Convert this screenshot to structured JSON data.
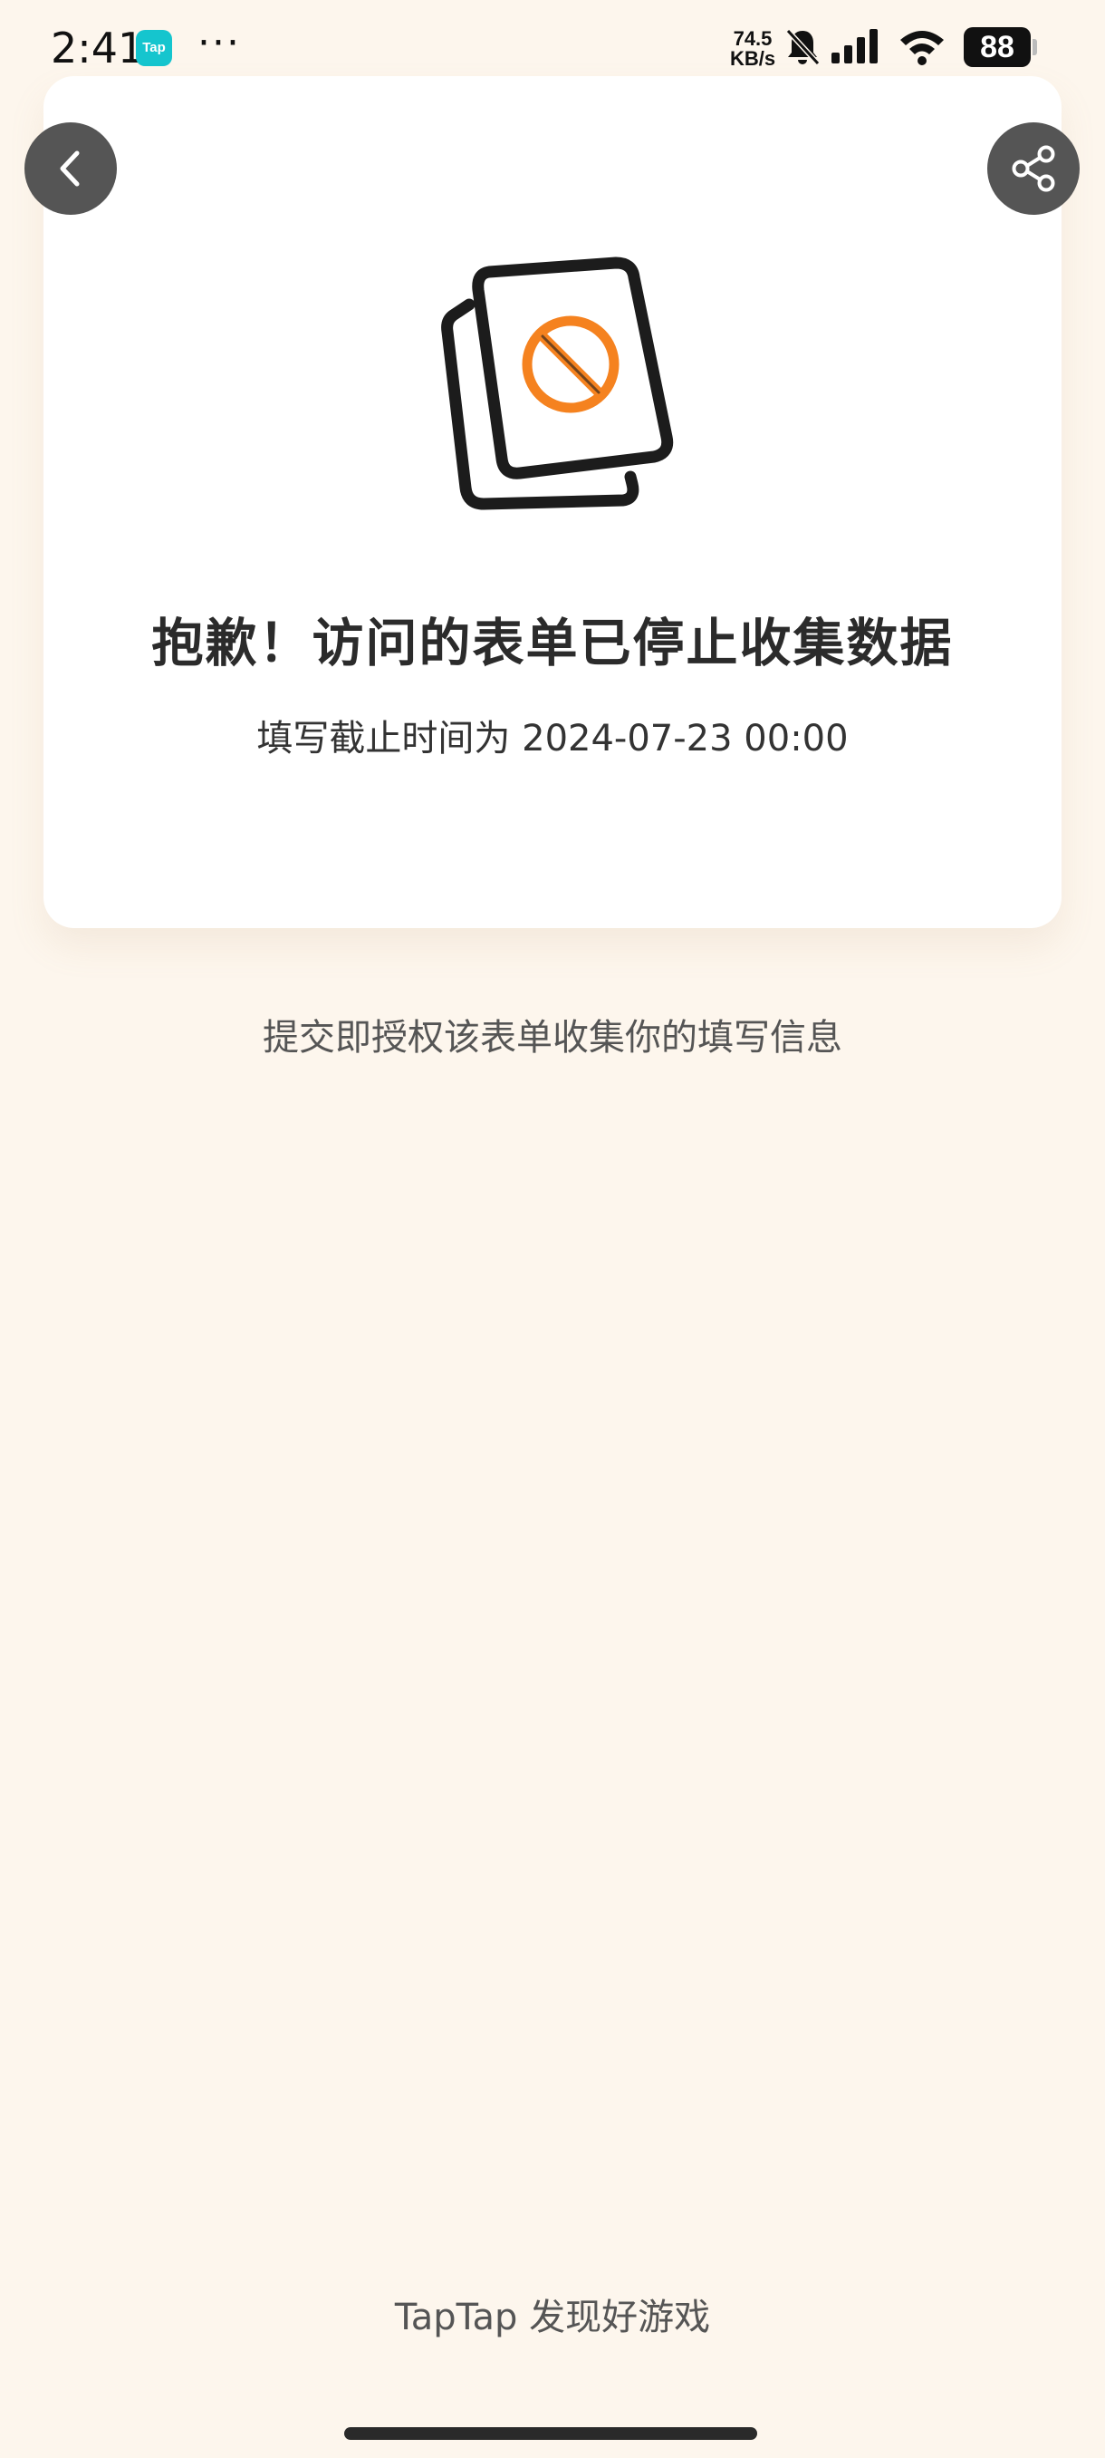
{
  "status_bar": {
    "time": "2:41",
    "app_badge": "Tap",
    "more": "···",
    "net_speed_value": "74.5",
    "net_speed_unit": "KB/s",
    "battery": "88",
    "icons": [
      "bell-off-icon",
      "signal-icon",
      "wifi-icon",
      "battery-icon"
    ]
  },
  "nav": {
    "back_icon": "chevron-left-icon",
    "share_icon": "share-icon"
  },
  "card": {
    "illustration": "form-closed-icon",
    "title": "抱歉！访问的表单已停止收集数据",
    "subtitle": "填写截止时间为 2024-07-23 00:00"
  },
  "consent_text": "提交即授权该表单收集你的填写信息",
  "footer": {
    "brand": "TapTap 发现好游戏"
  },
  "colors": {
    "background": "#fdf6ed",
    "card": "#ffffff",
    "accent": "#f5821f",
    "nav_button": "#555555"
  }
}
